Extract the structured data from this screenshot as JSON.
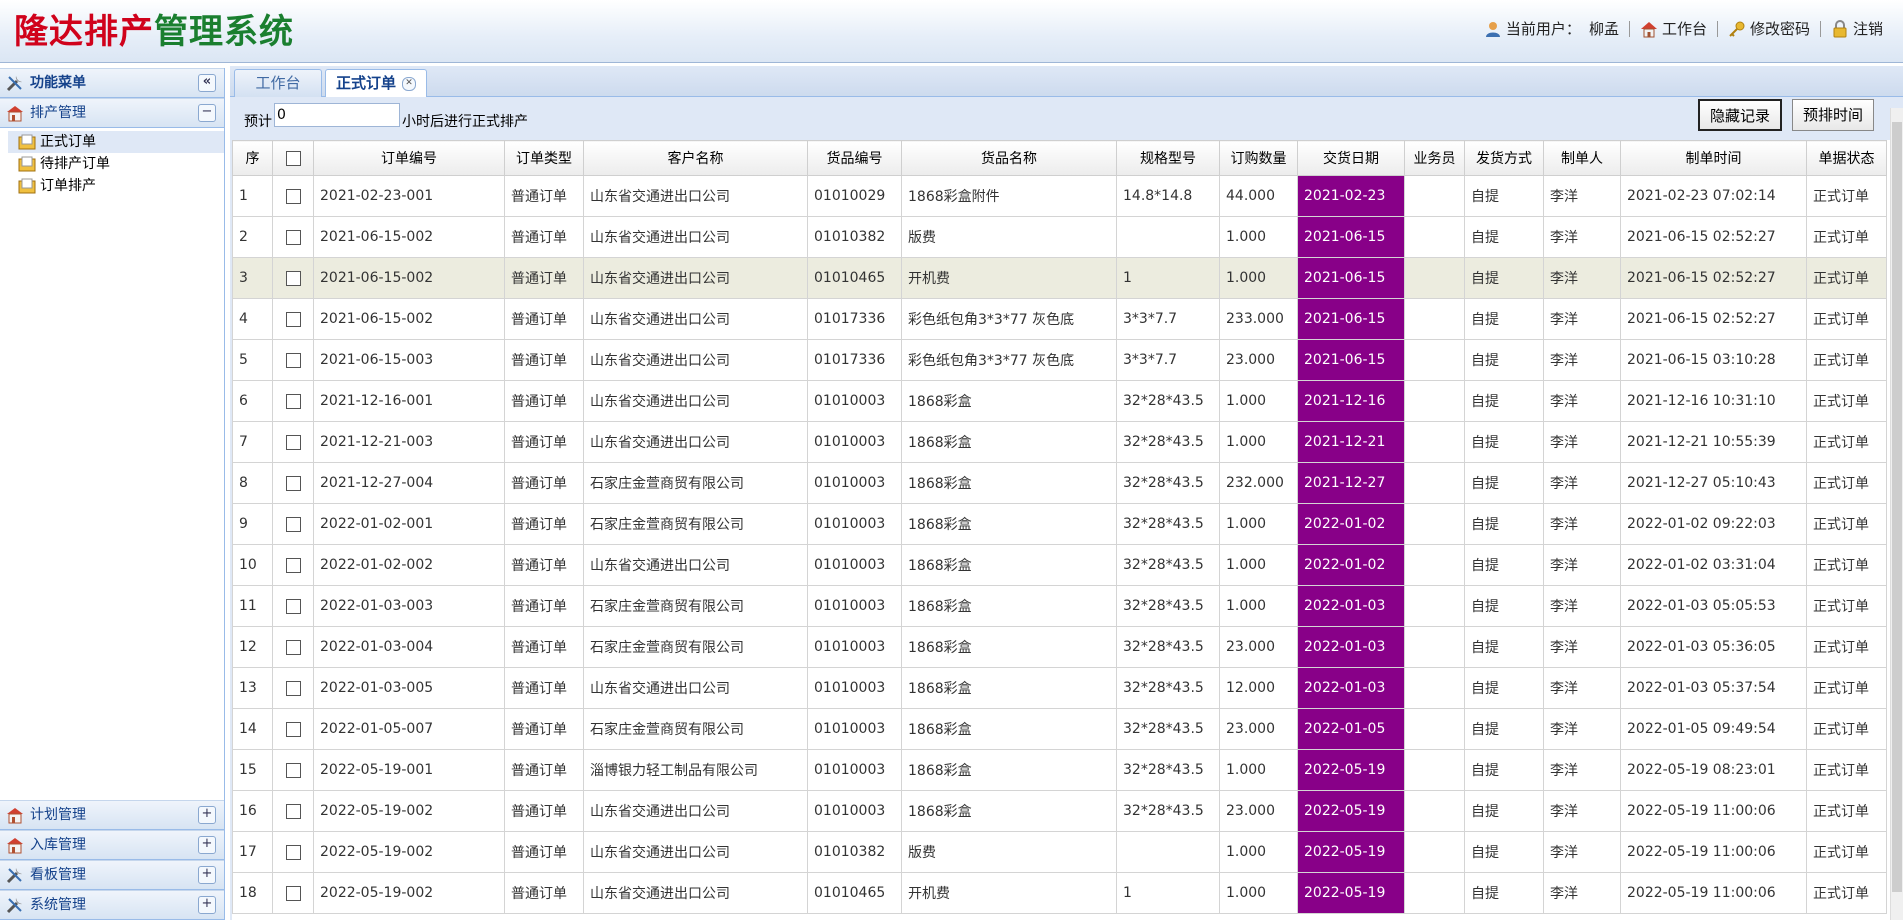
{
  "app": {
    "logo_part1": "隆达排产",
    "logo_part2": "管理系统"
  },
  "topbar": {
    "current_user_label": "当前用户：",
    "current_user_name": "柳孟",
    "workbench": "工作台",
    "change_password": "修改密码",
    "logout": "注销"
  },
  "sidebar": {
    "title": "功能菜单",
    "sections": [
      {
        "label": "排产管理",
        "expanded": true
      },
      {
        "label": "计划管理"
      },
      {
        "label": "入库管理"
      },
      {
        "label": "看板管理"
      },
      {
        "label": "系统管理"
      }
    ],
    "items": [
      {
        "label": "正式订单",
        "selected": true
      },
      {
        "label": "待排产订单"
      },
      {
        "label": "订单排产"
      }
    ]
  },
  "tabs": [
    {
      "label": "工作台"
    },
    {
      "label": "正式订单",
      "active": true
    }
  ],
  "toolbar": {
    "estimate_prefix": "预计",
    "estimate_value": "0",
    "estimate_suffix": "小时后进行正式排产",
    "hide_records": "隐藏记录",
    "pre_schedule_time": "预排时间"
  },
  "colors": {
    "date_cell_bg": "#880088",
    "highlight_row_bg": "#ececdf"
  },
  "grid": {
    "columns": [
      "序",
      "",
      "订单编号",
      "订单类型",
      "客户名称",
      "货品编号",
      "货品名称",
      "规格型号",
      "订购数量",
      "交货日期",
      "业务员",
      "发货方式",
      "制单人",
      "制单时间",
      "单据状态"
    ],
    "rows": [
      [
        "1",
        "2021-02-23-001",
        "普通订单",
        "山东省交通进出口公司",
        "01010029",
        "1868彩盒附件",
        "14.8*14.8",
        "44.000",
        "2021-02-23",
        "",
        "自提",
        "李洋",
        "2021-02-23 07:02:14",
        "正式订单"
      ],
      [
        "2",
        "2021-06-15-002",
        "普通订单",
        "山东省交通进出口公司",
        "01010382",
        "版费",
        "",
        "1.000",
        "2021-06-15",
        "",
        "自提",
        "李洋",
        "2021-06-15 02:52:27",
        "正式订单"
      ],
      [
        "3",
        "2021-06-15-002",
        "普通订单",
        "山东省交通进出口公司",
        "01010465",
        "开机费",
        "1",
        "1.000",
        "2021-06-15",
        "",
        "自提",
        "李洋",
        "2021-06-15 02:52:27",
        "正式订单"
      ],
      [
        "4",
        "2021-06-15-002",
        "普通订单",
        "山东省交通进出口公司",
        "01017336",
        "彩色纸包角3*3*77 灰色底",
        "3*3*7.7",
        "233.000",
        "2021-06-15",
        "",
        "自提",
        "李洋",
        "2021-06-15 02:52:27",
        "正式订单"
      ],
      [
        "5",
        "2021-06-15-003",
        "普通订单",
        "山东省交通进出口公司",
        "01017336",
        "彩色纸包角3*3*77 灰色底",
        "3*3*7.7",
        "23.000",
        "2021-06-15",
        "",
        "自提",
        "李洋",
        "2021-06-15 03:10:28",
        "正式订单"
      ],
      [
        "6",
        "2021-12-16-001",
        "普通订单",
        "山东省交通进出口公司",
        "01010003",
        "1868彩盒",
        "32*28*43.5",
        "1.000",
        "2021-12-16",
        "",
        "自提",
        "李洋",
        "2021-12-16 10:31:10",
        "正式订单"
      ],
      [
        "7",
        "2021-12-21-003",
        "普通订单",
        "山东省交通进出口公司",
        "01010003",
        "1868彩盒",
        "32*28*43.5",
        "1.000",
        "2021-12-21",
        "",
        "自提",
        "李洋",
        "2021-12-21 10:55:39",
        "正式订单"
      ],
      [
        "8",
        "2021-12-27-004",
        "普通订单",
        "石家庄金萱商贸有限公司",
        "01010003",
        "1868彩盒",
        "32*28*43.5",
        "232.000",
        "2021-12-27",
        "",
        "自提",
        "李洋",
        "2021-12-27 05:10:43",
        "正式订单"
      ],
      [
        "9",
        "2022-01-02-001",
        "普通订单",
        "石家庄金萱商贸有限公司",
        "01010003",
        "1868彩盒",
        "32*28*43.5",
        "1.000",
        "2022-01-02",
        "",
        "自提",
        "李洋",
        "2022-01-02 09:22:03",
        "正式订单"
      ],
      [
        "10",
        "2022-01-02-002",
        "普通订单",
        "山东省交通进出口公司",
        "01010003",
        "1868彩盒",
        "32*28*43.5",
        "1.000",
        "2022-01-02",
        "",
        "自提",
        "李洋",
        "2022-01-02 03:31:04",
        "正式订单"
      ],
      [
        "11",
        "2022-01-03-003",
        "普通订单",
        "石家庄金萱商贸有限公司",
        "01010003",
        "1868彩盒",
        "32*28*43.5",
        "1.000",
        "2022-01-03",
        "",
        "自提",
        "李洋",
        "2022-01-03 05:05:53",
        "正式订单"
      ],
      [
        "12",
        "2022-01-03-004",
        "普通订单",
        "石家庄金萱商贸有限公司",
        "01010003",
        "1868彩盒",
        "32*28*43.5",
        "23.000",
        "2022-01-03",
        "",
        "自提",
        "李洋",
        "2022-01-03 05:36:05",
        "正式订单"
      ],
      [
        "13",
        "2022-01-03-005",
        "普通订单",
        "山东省交通进出口公司",
        "01010003",
        "1868彩盒",
        "32*28*43.5",
        "12.000",
        "2022-01-03",
        "",
        "自提",
        "李洋",
        "2022-01-03 05:37:54",
        "正式订单"
      ],
      [
        "14",
        "2022-01-05-007",
        "普通订单",
        "石家庄金萱商贸有限公司",
        "01010003",
        "1868彩盒",
        "32*28*43.5",
        "23.000",
        "2022-01-05",
        "",
        "自提",
        "李洋",
        "2022-01-05 09:49:54",
        "正式订单"
      ],
      [
        "15",
        "2022-05-19-001",
        "普通订单",
        "淄博银力轻工制品有限公司",
        "01010003",
        "1868彩盒",
        "32*28*43.5",
        "1.000",
        "2022-05-19",
        "",
        "自提",
        "李洋",
        "2022-05-19 08:23:01",
        "正式订单"
      ],
      [
        "16",
        "2022-05-19-002",
        "普通订单",
        "山东省交通进出口公司",
        "01010003",
        "1868彩盒",
        "32*28*43.5",
        "23.000",
        "2022-05-19",
        "",
        "自提",
        "李洋",
        "2022-05-19 11:00:06",
        "正式订单"
      ],
      [
        "17",
        "2022-05-19-002",
        "普通订单",
        "山东省交通进出口公司",
        "01010382",
        "版费",
        "",
        "1.000",
        "2022-05-19",
        "",
        "自提",
        "李洋",
        "2022-05-19 11:00:06",
        "正式订单"
      ],
      [
        "18",
        "2022-05-19-002",
        "普通订单",
        "山东省交通进出口公司",
        "01010465",
        "开机费",
        "1",
        "1.000",
        "2022-05-19",
        "",
        "自提",
        "李洋",
        "2022-05-19 11:00:06",
        "正式订单"
      ]
    ],
    "highlighted_row": 3
  }
}
